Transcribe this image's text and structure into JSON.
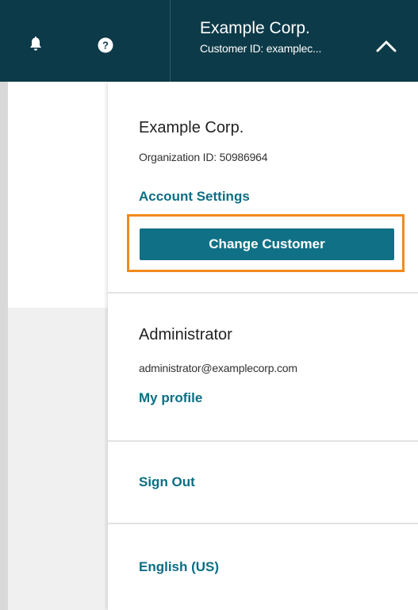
{
  "header": {
    "org_name": "Example Corp.",
    "customer_id": "Customer ID: examplec...",
    "icons": [
      "bell-icon",
      "help-icon",
      "chevron-up-icon"
    ],
    "background_color": "#0d3a48"
  },
  "menu": {
    "organization": {
      "name": "Example Corp.",
      "org_id": "Organization ID: 50986964",
      "account_settings_label": "Account Settings",
      "change_customer_label": "Change Customer"
    },
    "user": {
      "role": "Administrator",
      "email": "administrator@examplecorp.com",
      "profile_label": "My profile"
    },
    "sign_out_label": "Sign Out",
    "language_label": "English (US)"
  },
  "colors": {
    "accent": "#107186",
    "link": "#0b6e84",
    "highlight": "#f18a1c"
  }
}
